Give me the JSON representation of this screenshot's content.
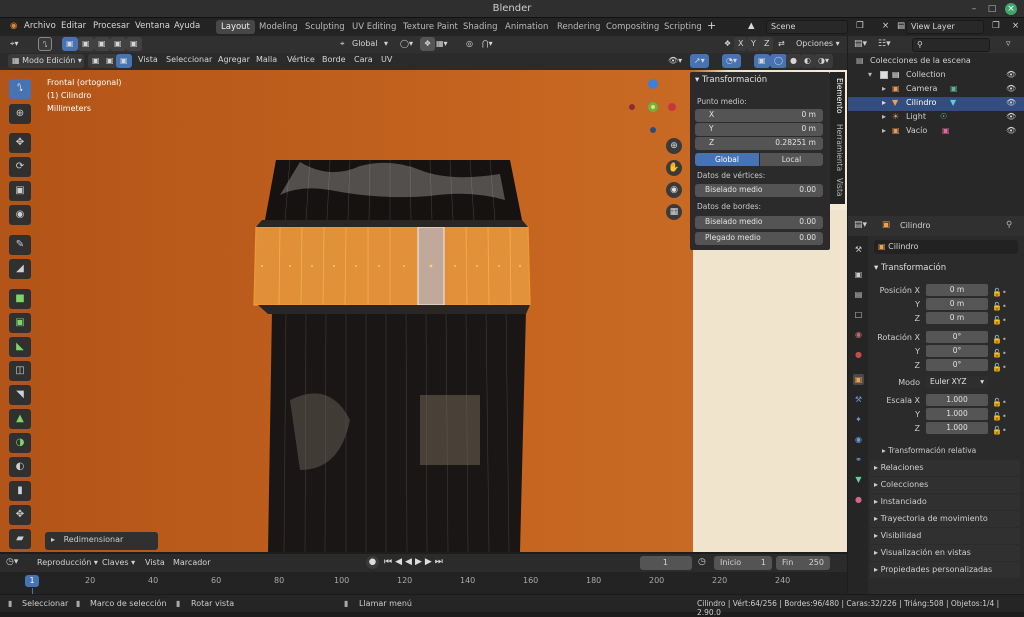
{
  "window": {
    "title": "Blender"
  },
  "menu": {
    "items": [
      "Archivo",
      "Editar",
      "Procesar",
      "Ventana",
      "Ayuda"
    ]
  },
  "workspaces": [
    "Layout",
    "Modeling",
    "Sculpting",
    "UV Editing",
    "Texture Paint",
    "Shading",
    "Animation",
    "Rendering",
    "Compositing",
    "Scripting"
  ],
  "scene": {
    "label": "Scene"
  },
  "viewlayer": {
    "label": "View Layer"
  },
  "vpheader": {
    "orientation": "Global",
    "axes": [
      "X",
      "Y",
      "Z"
    ],
    "options": "Opciones"
  },
  "vpheader2": {
    "mode": "Modo Edición",
    "menus": [
      "Vista",
      "Seleccionar",
      "Agregar",
      "Malla",
      "Vértice",
      "Borde",
      "Cara",
      "UV"
    ]
  },
  "viewport_info": {
    "line1": "Frontal (ortogonal)",
    "line2": "(1) Cilindro",
    "line3": "Millimeters"
  },
  "operator_panel": {
    "label": "Redimensionar"
  },
  "npanel": {
    "title": "Transformación",
    "midpoint_label": "Punto medio:",
    "fields": [
      {
        "label": "X",
        "value": "0 m"
      },
      {
        "label": "Y",
        "value": "0 m"
      },
      {
        "label": "Z",
        "value": "0.28251 m"
      }
    ],
    "toggle": {
      "global": "Global",
      "local": "Local"
    },
    "vertex_data_label": "Datos de vértices:",
    "vertex_bevel": {
      "label": "Biselado medio",
      "value": "0.00"
    },
    "edge_data_label": "Datos de bordes:",
    "edge_bevel": {
      "label": "Biselado medio",
      "value": "0.00"
    },
    "crease": {
      "label": "Plegado medio",
      "value": "0.00"
    },
    "tabs": [
      "Elemento",
      "Herramienta",
      "Vista"
    ]
  },
  "outliner": {
    "scene_collection": "Colecciones de la escena",
    "items": [
      {
        "name": "Collection"
      },
      {
        "name": "Camera"
      },
      {
        "name": "Cilindro"
      },
      {
        "name": "Light"
      },
      {
        "name": "Vacío"
      }
    ]
  },
  "properties": {
    "object_name": "Cilindro",
    "object_field": "Cilindro",
    "section_transform": "Transformación",
    "location": {
      "label_x": "Posición X",
      "label_y": "Y",
      "label_z": "Z",
      "x": "0 m",
      "y": "0 m",
      "z": "0 m"
    },
    "rotation": {
      "label_x": "Rotación X",
      "label_y": "Y",
      "label_z": "Z",
      "x": "0°",
      "y": "0°",
      "z": "0°"
    },
    "mode": {
      "label": "Modo",
      "value": "Euler XYZ"
    },
    "scale": {
      "label_x": "Escala X",
      "label_y": "Y",
      "label_z": "Z",
      "x": "1.000",
      "y": "1.000",
      "z": "1.000"
    },
    "relative": "Transformación relativa",
    "sections": [
      "Relaciones",
      "Colecciones",
      "Instanciado",
      "Trayectoria de movimiento",
      "Visibilidad",
      "Visualización en vistas",
      "Propiedades personalizadas"
    ]
  },
  "timeline": {
    "menus": [
      "Reproducción",
      "Claves",
      "Vista",
      "Marcador"
    ],
    "current_frame": "1",
    "start_label": "Inicio",
    "start": "1",
    "end_label": "Fin",
    "end": "250",
    "ticks": [
      "1",
      "20",
      "40",
      "60",
      "80",
      "100",
      "120",
      "140",
      "160",
      "180",
      "200",
      "220",
      "240"
    ]
  },
  "statusbar": {
    "select": "Seleccionar",
    "box": "Marco de selección",
    "rotate": "Rotar vista",
    "menu": "Llamar menú",
    "stats": "Cilindro | Vért:64/256 | Bordes:96/480 | Caras:32/226 | Triáng:508 | Objetos:1/4 | 2.90.0"
  },
  "colors": {
    "accent": "#4772b3",
    "viewport_bg": "#b85a1e",
    "selection": "#f0a030"
  }
}
